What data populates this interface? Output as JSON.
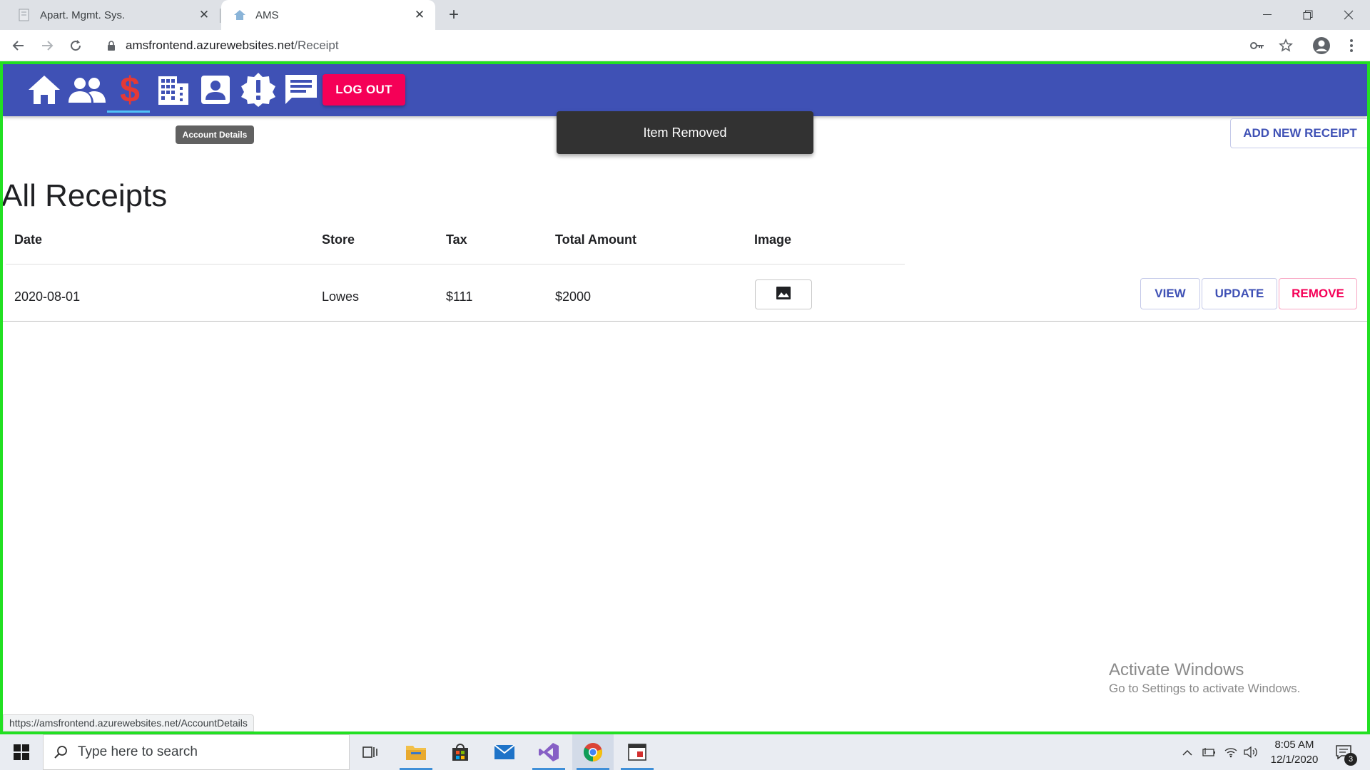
{
  "browser": {
    "tabs": [
      {
        "title": "Apart. Mgmt. Sys.",
        "active": false
      },
      {
        "title": "AMS",
        "active": true
      }
    ],
    "address": {
      "host": "amsfrontend.azurewebsites.net",
      "path": "/Receipt"
    },
    "status_url": "https://amsfrontend.azurewebsites.net/AccountDetails"
  },
  "app": {
    "nav_icons": [
      "home-icon",
      "people-icon",
      "dollar-icon",
      "building-icon",
      "account-icon",
      "alert-icon",
      "message-icon"
    ],
    "active_nav": "dollar-icon",
    "logout_label": "LOG OUT",
    "tooltip": "Account Details",
    "snackbar": "Item Removed",
    "add_button": "ADD NEW RECEIPT",
    "title": "All Receipts",
    "table": {
      "headers": [
        "Date",
        "Store",
        "Tax",
        "Total Amount",
        "Image"
      ],
      "rows": [
        {
          "date": "2020-08-01",
          "store": "Lowes",
          "tax": "$111",
          "total": "$2000",
          "image": "image-icon"
        }
      ],
      "actions": [
        "VIEW",
        "UPDATE",
        "REMOVE"
      ]
    },
    "colors": {
      "appbar": "#3f51b5",
      "accent": "#f50057",
      "active_icon": "#e53935",
      "frame": "#22e022"
    }
  },
  "watermark": {
    "title": "Activate Windows",
    "subtitle": "Go to Settings to activate Windows."
  },
  "taskbar": {
    "search_placeholder": "Type here to search",
    "time": "8:05 AM",
    "date": "12/1/2020",
    "notifications": "3"
  }
}
